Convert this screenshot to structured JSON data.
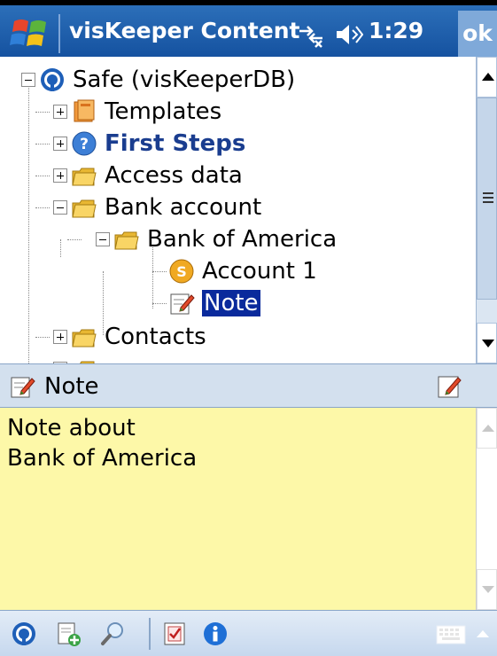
{
  "titlebar": {
    "title": "visKeeper Content",
    "time": "1:29",
    "ok_label": "ok",
    "icons": [
      "windows-start-icon",
      "connectivity-icon",
      "volume-icon"
    ]
  },
  "tree": {
    "nodes": [
      {
        "label": "Safe (visKeeperDB)",
        "icon": "safe-icon",
        "expander": "minus",
        "level": 0
      },
      {
        "label": "Templates",
        "icon": "templates-book-icon",
        "expander": "plus",
        "level": 1
      },
      {
        "label": "First Steps",
        "icon": "help-icon",
        "expander": "plus",
        "level": 1,
        "style": "bold"
      },
      {
        "label": "Access data",
        "icon": "folder-icon",
        "expander": "plus",
        "level": 1
      },
      {
        "label": "Bank account",
        "icon": "folder-icon",
        "expander": "minus",
        "level": 1
      },
      {
        "label": "Bank of America",
        "icon": "folder-icon",
        "expander": "minus",
        "level": 2
      },
      {
        "label": "Account 1",
        "icon": "account-coin-icon",
        "level": 3
      },
      {
        "label": "Note",
        "icon": "note-icon",
        "level": 3,
        "selected": true
      },
      {
        "label": "Contacts",
        "icon": "folder-icon",
        "expander": "plus",
        "level": 1
      }
    ]
  },
  "note_panel": {
    "title": "Note",
    "body": "Note about\nBank of America"
  },
  "toolbar": {
    "buttons": [
      "safe-icon",
      "new-item-icon",
      "search-icon",
      "checklist-icon",
      "info-icon"
    ],
    "keyboard": "keyboard-icon"
  },
  "colors": {
    "titlebar": "#1552a0",
    "selection": "#0a2a9c",
    "note_bg": "#fdf8a8",
    "panel_header": "#d3e0ee"
  }
}
